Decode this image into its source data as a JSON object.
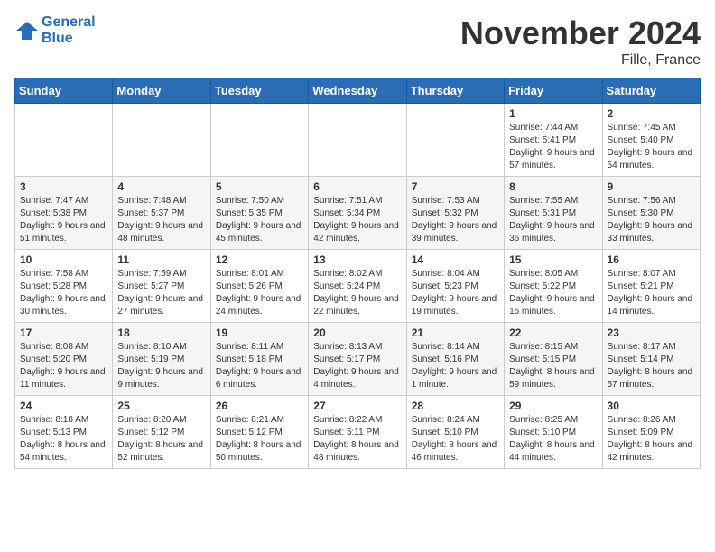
{
  "header": {
    "logo_line1": "General",
    "logo_line2": "Blue",
    "month": "November 2024",
    "location": "Fille, France"
  },
  "weekdays": [
    "Sunday",
    "Monday",
    "Tuesday",
    "Wednesday",
    "Thursday",
    "Friday",
    "Saturday"
  ],
  "weeks": [
    [
      {
        "day": "",
        "info": ""
      },
      {
        "day": "",
        "info": ""
      },
      {
        "day": "",
        "info": ""
      },
      {
        "day": "",
        "info": ""
      },
      {
        "day": "",
        "info": ""
      },
      {
        "day": "1",
        "info": "Sunrise: 7:44 AM\nSunset: 5:41 PM\nDaylight: 9 hours and 57 minutes."
      },
      {
        "day": "2",
        "info": "Sunrise: 7:45 AM\nSunset: 5:40 PM\nDaylight: 9 hours and 54 minutes."
      }
    ],
    [
      {
        "day": "3",
        "info": "Sunrise: 7:47 AM\nSunset: 5:38 PM\nDaylight: 9 hours and 51 minutes."
      },
      {
        "day": "4",
        "info": "Sunrise: 7:48 AM\nSunset: 5:37 PM\nDaylight: 9 hours and 48 minutes."
      },
      {
        "day": "5",
        "info": "Sunrise: 7:50 AM\nSunset: 5:35 PM\nDaylight: 9 hours and 45 minutes."
      },
      {
        "day": "6",
        "info": "Sunrise: 7:51 AM\nSunset: 5:34 PM\nDaylight: 9 hours and 42 minutes."
      },
      {
        "day": "7",
        "info": "Sunrise: 7:53 AM\nSunset: 5:32 PM\nDaylight: 9 hours and 39 minutes."
      },
      {
        "day": "8",
        "info": "Sunrise: 7:55 AM\nSunset: 5:31 PM\nDaylight: 9 hours and 36 minutes."
      },
      {
        "day": "9",
        "info": "Sunrise: 7:56 AM\nSunset: 5:30 PM\nDaylight: 9 hours and 33 minutes."
      }
    ],
    [
      {
        "day": "10",
        "info": "Sunrise: 7:58 AM\nSunset: 5:28 PM\nDaylight: 9 hours and 30 minutes."
      },
      {
        "day": "11",
        "info": "Sunrise: 7:59 AM\nSunset: 5:27 PM\nDaylight: 9 hours and 27 minutes."
      },
      {
        "day": "12",
        "info": "Sunrise: 8:01 AM\nSunset: 5:26 PM\nDaylight: 9 hours and 24 minutes."
      },
      {
        "day": "13",
        "info": "Sunrise: 8:02 AM\nSunset: 5:24 PM\nDaylight: 9 hours and 22 minutes."
      },
      {
        "day": "14",
        "info": "Sunrise: 8:04 AM\nSunset: 5:23 PM\nDaylight: 9 hours and 19 minutes."
      },
      {
        "day": "15",
        "info": "Sunrise: 8:05 AM\nSunset: 5:22 PM\nDaylight: 9 hours and 16 minutes."
      },
      {
        "day": "16",
        "info": "Sunrise: 8:07 AM\nSunset: 5:21 PM\nDaylight: 9 hours and 14 minutes."
      }
    ],
    [
      {
        "day": "17",
        "info": "Sunrise: 8:08 AM\nSunset: 5:20 PM\nDaylight: 9 hours and 11 minutes."
      },
      {
        "day": "18",
        "info": "Sunrise: 8:10 AM\nSunset: 5:19 PM\nDaylight: 9 hours and 9 minutes."
      },
      {
        "day": "19",
        "info": "Sunrise: 8:11 AM\nSunset: 5:18 PM\nDaylight: 9 hours and 6 minutes."
      },
      {
        "day": "20",
        "info": "Sunrise: 8:13 AM\nSunset: 5:17 PM\nDaylight: 9 hours and 4 minutes."
      },
      {
        "day": "21",
        "info": "Sunrise: 8:14 AM\nSunset: 5:16 PM\nDaylight: 9 hours and 1 minute."
      },
      {
        "day": "22",
        "info": "Sunrise: 8:15 AM\nSunset: 5:15 PM\nDaylight: 8 hours and 59 minutes."
      },
      {
        "day": "23",
        "info": "Sunrise: 8:17 AM\nSunset: 5:14 PM\nDaylight: 8 hours and 57 minutes."
      }
    ],
    [
      {
        "day": "24",
        "info": "Sunrise: 8:18 AM\nSunset: 5:13 PM\nDaylight: 8 hours and 54 minutes."
      },
      {
        "day": "25",
        "info": "Sunrise: 8:20 AM\nSunset: 5:12 PM\nDaylight: 8 hours and 52 minutes."
      },
      {
        "day": "26",
        "info": "Sunrise: 8:21 AM\nSunset: 5:12 PM\nDaylight: 8 hours and 50 minutes."
      },
      {
        "day": "27",
        "info": "Sunrise: 8:22 AM\nSunset: 5:11 PM\nDaylight: 8 hours and 48 minutes."
      },
      {
        "day": "28",
        "info": "Sunrise: 8:24 AM\nSunset: 5:10 PM\nDaylight: 8 hours and 46 minutes."
      },
      {
        "day": "29",
        "info": "Sunrise: 8:25 AM\nSunset: 5:10 PM\nDaylight: 8 hours and 44 minutes."
      },
      {
        "day": "30",
        "info": "Sunrise: 8:26 AM\nSunset: 5:09 PM\nDaylight: 8 hours and 42 minutes."
      }
    ]
  ]
}
